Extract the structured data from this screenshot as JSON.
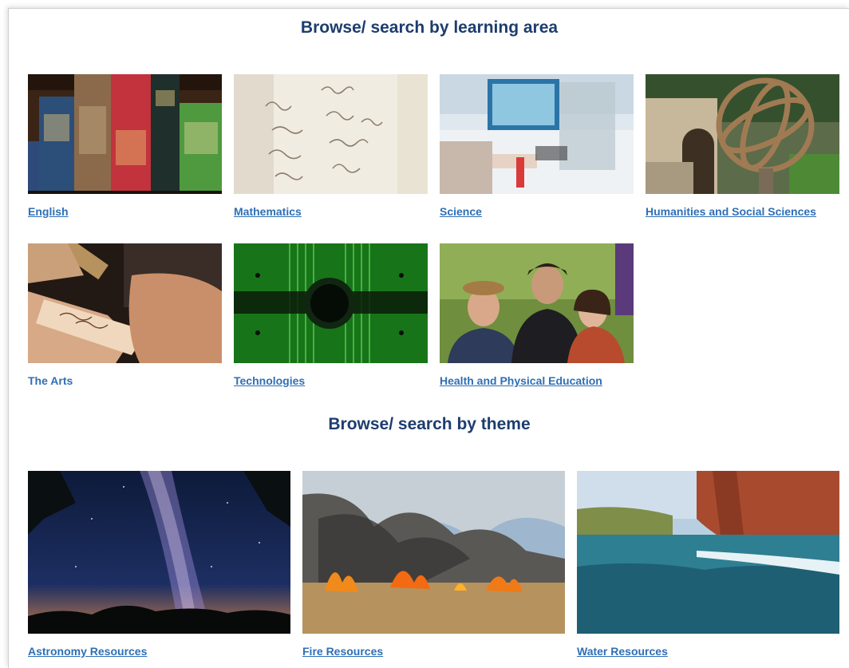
{
  "sections": {
    "learning_area": {
      "heading": "Browse/ search by learning area",
      "items": [
        {
          "label": "English",
          "image": "books-photo"
        },
        {
          "label": "Mathematics",
          "image": "handwritten-equations-photo"
        },
        {
          "label": "Science",
          "image": "lab-pipette-photo"
        },
        {
          "label": "Humanities and Social Sciences",
          "image": "armillary-sphere-photo"
        },
        {
          "label": "The Arts",
          "image": "pyrography-photo"
        },
        {
          "label": "Technologies",
          "image": "green-microchip-photo"
        },
        {
          "label": "Health and Physical Education",
          "image": "three-people-outdoors-photo"
        }
      ]
    },
    "theme": {
      "heading": "Browse/ search by theme",
      "items": [
        {
          "label": "Astronomy Resources",
          "image": "milky-way-night-sky-photo"
        },
        {
          "label": "Fire Resources",
          "image": "bushfire-smoke-photo"
        },
        {
          "label": "Water Resources",
          "image": "river-gorge-photo"
        }
      ]
    }
  },
  "colors": {
    "heading": "#1c3d6e",
    "link": "#2f6fb5"
  }
}
